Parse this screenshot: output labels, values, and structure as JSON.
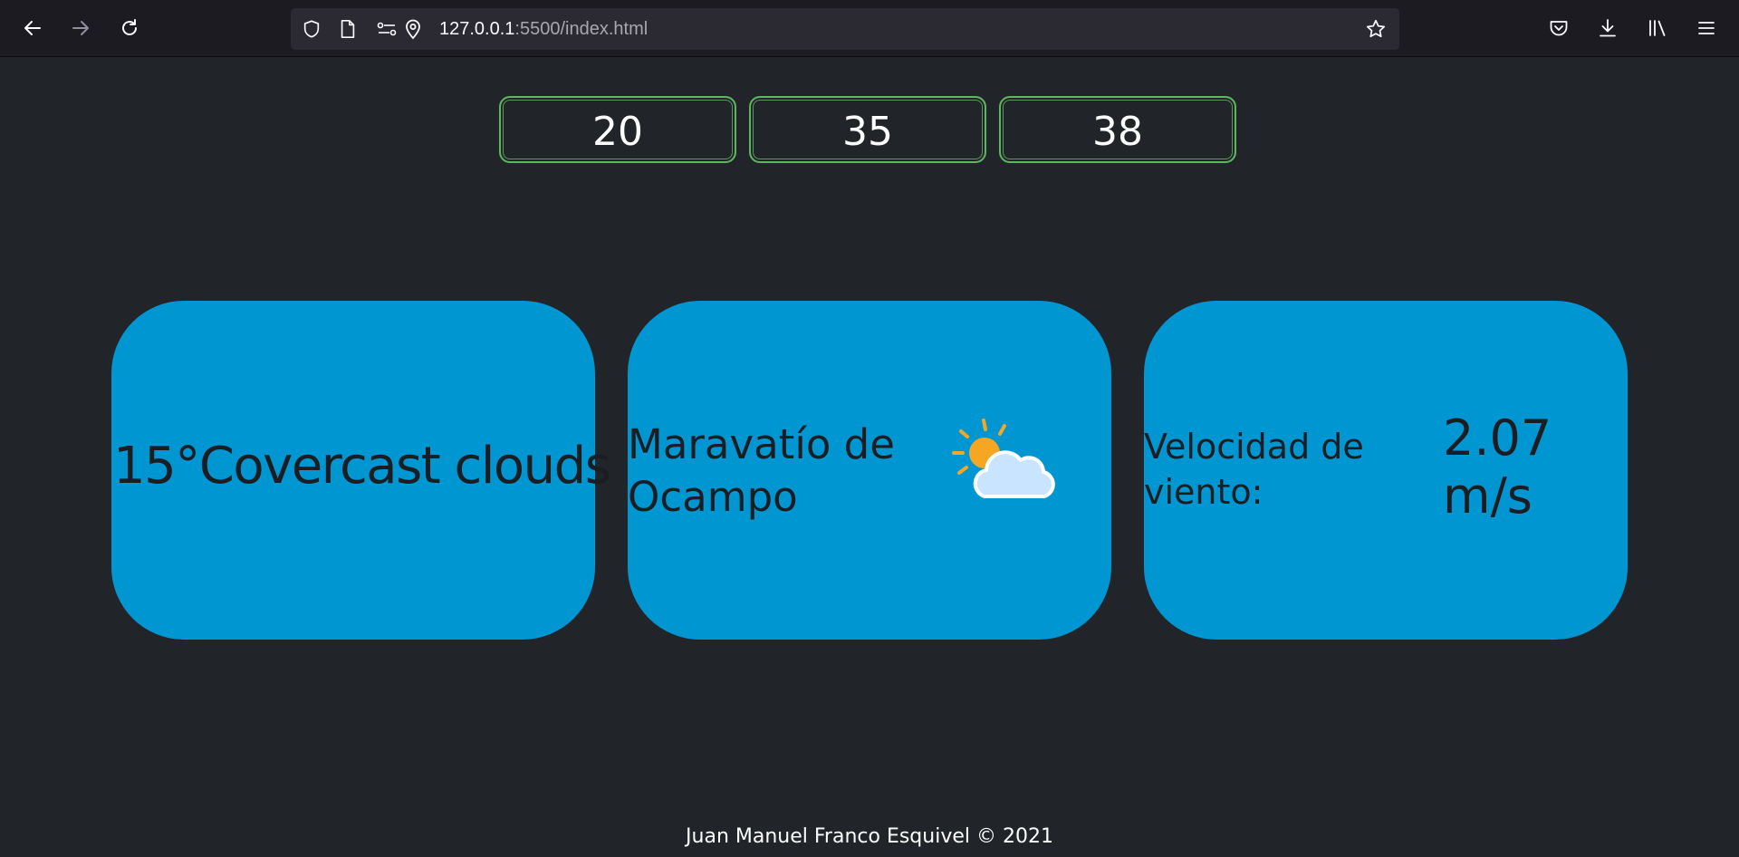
{
  "browser": {
    "url_host": "127.0.0.1",
    "url_rest": ":5500/index.html",
    "icons": {
      "back": "arrow-left-icon",
      "forward": "arrow-right-icon",
      "reload": "reload-icon",
      "shield": "shield-icon",
      "page": "page-icon",
      "permissions": "permissions-icon",
      "location": "location-pin-icon",
      "bookmark": "star-icon",
      "pocket": "pocket-icon",
      "downloads": "download-icon",
      "library": "library-icon",
      "menu": "hamburger-menu-icon"
    }
  },
  "numbers": [
    "20",
    "35",
    "38"
  ],
  "cards": {
    "temperature": "15°Covercast clouds",
    "city": "Maravatío de Ocampo",
    "weather_icon": "partly-cloudy-icon",
    "wind_label": "Velocidad de viento:",
    "wind_value": "2.07 m/s"
  },
  "footer": "Juan Manuel Franco Esquivel © 2021",
  "colors": {
    "background": "#212529",
    "card": "#0096d2",
    "number_border": "#5cb85c"
  }
}
